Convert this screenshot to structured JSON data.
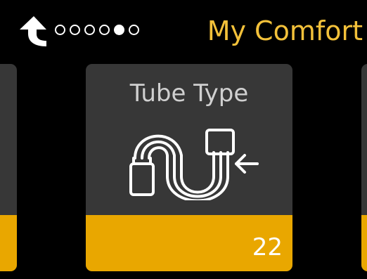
{
  "header": {
    "back_icon": "up-arrow-back-icon",
    "page_dots": [
      {
        "active": false
      },
      {
        "active": false
      },
      {
        "active": false
      },
      {
        "active": false
      },
      {
        "active": true
      },
      {
        "active": false
      }
    ],
    "title": "My Comfort"
  },
  "carousel": {
    "current": {
      "title": "Tube Type",
      "icon": "tube-icon",
      "value": "22"
    }
  },
  "colors": {
    "background": "#000000",
    "card": "#373737",
    "accent": "#e9a700",
    "title": "#f3c13a"
  }
}
